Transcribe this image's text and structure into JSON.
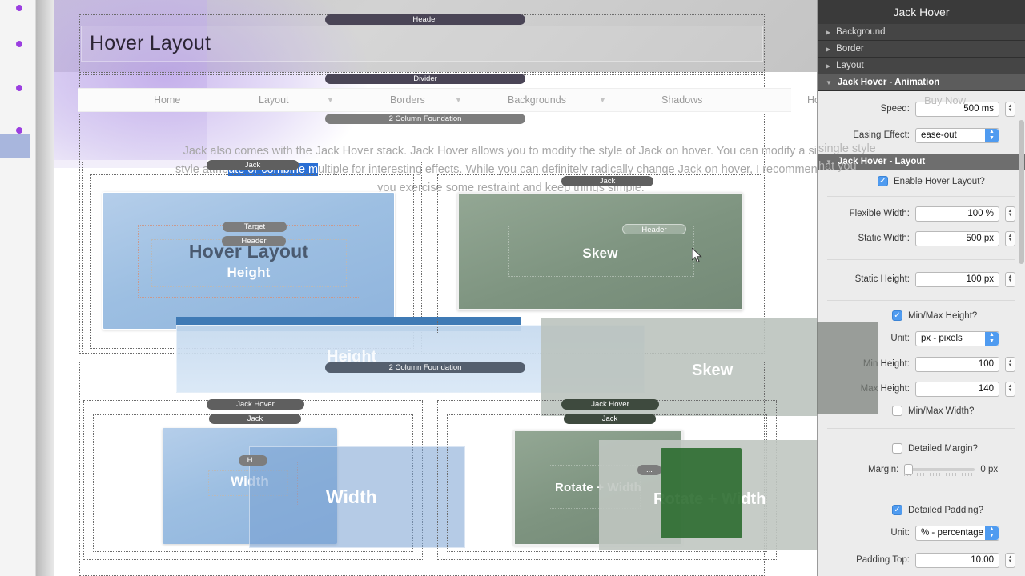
{
  "hero": {
    "title": "Hover Layout"
  },
  "nav": {
    "items": [
      {
        "label": "Home",
        "caret": false
      },
      {
        "label": "Layout",
        "caret": true
      },
      {
        "label": "Borders",
        "caret": true
      },
      {
        "label": "Backgrounds",
        "caret": true
      },
      {
        "label": "Shadows",
        "caret": false
      },
      {
        "label": "Hover",
        "caret": false
      }
    ]
  },
  "stack_labels": {
    "header": "Header",
    "divider": "Divider",
    "two_column": "2 Column Foundation",
    "target": "Target",
    "jack": "Jack",
    "jack_hover": "Jack Hover",
    "header_small": "Header",
    "ellipsis": "H..."
  },
  "body": {
    "part1": "Jack also comes with the Jack Hover stack. Jack Hover allows you to modify the style of Jack on hover. You can modify a single style attrib",
    "selected": "ute or combine m",
    "part2": "ultiple for interesting effects. While you can definitely radically change Jack on hover, I recommend that you exercise some restraint and keep things simple."
  },
  "cards": {
    "top_left": {
      "title": "Hover Layout",
      "sub": "Height",
      "ghost": "Height"
    },
    "top_right": {
      "title": "Skew",
      "sub": "",
      "ghost": "Skew"
    },
    "bot_left": {
      "title": "Width",
      "sub": "",
      "ghost": "Width"
    },
    "bot_right": {
      "title": "Rotate + Width",
      "sub": "",
      "ghost": "Rotate + Width"
    }
  },
  "overlay": {
    "buy_now": "Buy Now",
    "ghost_line1": "single style",
    "ghost_line2": "hat you"
  },
  "panel": {
    "title": "Jack Hover",
    "accordions": [
      {
        "label": "Background",
        "open": false
      },
      {
        "label": "Border",
        "open": false
      },
      {
        "label": "Layout",
        "open": false
      },
      {
        "label": "Jack Hover - Animation",
        "open": true
      },
      {
        "label": "Jack Hover - Layout",
        "open": true
      }
    ],
    "animation": {
      "speed_label": "Speed:",
      "speed_value": "500 ms",
      "easing_label": "Easing Effect:",
      "easing_value": "ease-out"
    },
    "layout": {
      "enable_hover_label": "Enable Hover Layout?",
      "enable_hover_checked": true,
      "flexible_width_label": "Flexible Width:",
      "flexible_width_value": "100 %",
      "static_width_label": "Static Width:",
      "static_width_value": "500 px",
      "static_height_label": "Static Height:",
      "static_height_value": "100 px",
      "minmax_height_label": "Min/Max Height?",
      "minmax_height_checked": true,
      "unit_label": "Unit:",
      "unit_value": "px - pixels",
      "min_height_label": "Min Height:",
      "min_height_value": "100",
      "max_height_label": "Max Height:",
      "max_height_value": "140",
      "minmax_width_label": "Min/Max Width?",
      "minmax_width_checked": false,
      "detailed_margin_label": "Detailed Margin?",
      "detailed_margin_checked": false,
      "margin_label": "Margin:",
      "margin_value": "0 px",
      "detailed_padding_label": "Detailed Padding?",
      "detailed_padding_checked": true,
      "padding_unit_label": "Unit:",
      "padding_unit_value": "% - percentage",
      "padding_top_label": "Padding Top:",
      "padding_top_value": "10.00"
    }
  },
  "colors": {
    "accent_blue": "#4f9bf0",
    "panel_dark": "#3a3a3a",
    "selection_blue": "#2a6fd4",
    "rail_dot_purple": "#9b3ee0",
    "card_blue": "#9dbfe2",
    "card_green": "#7e9480"
  }
}
